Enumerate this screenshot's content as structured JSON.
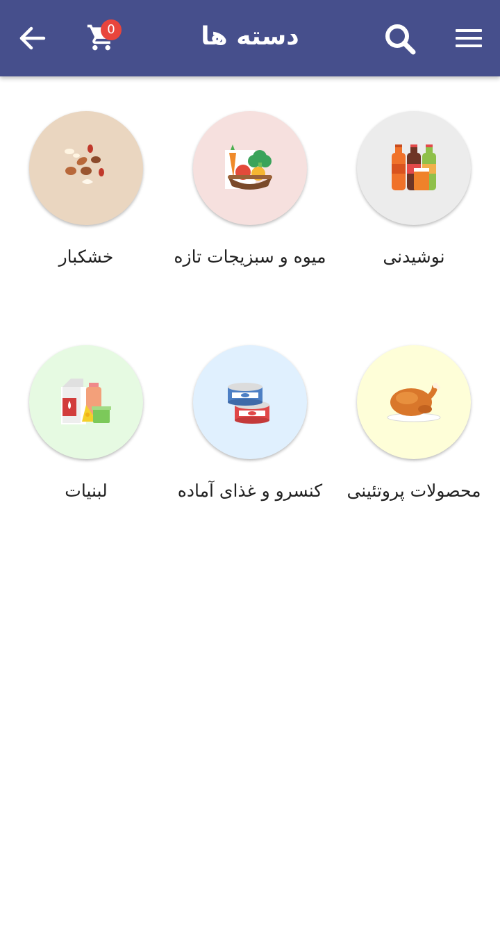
{
  "appbar": {
    "title": "دسته ها",
    "cart_count": "0",
    "background": "#464f8c"
  },
  "icons": [
    "menu-icon",
    "search-icon",
    "cart-icon",
    "back-arrow-icon"
  ],
  "categories": [
    {
      "label": "نوشیدنی",
      "icon": "soda-bottles-icon",
      "bg": "#ececec"
    },
    {
      "label": "میوه و سبزیجات تازه",
      "icon": "vegetable-basket-icon",
      "bg": "#f6e0de"
    },
    {
      "label": "خشکبار",
      "icon": "nuts-icon",
      "bg": "#ead6c0"
    },
    {
      "label": "محصولات پروتئینی",
      "icon": "roast-chicken-icon",
      "bg": "#fefed8"
    },
    {
      "label": "کنسرو و غذای آماده",
      "icon": "canned-food-icon",
      "bg": "#e0f0fe"
    },
    {
      "label": "لبنیات",
      "icon": "dairy-products-icon",
      "bg": "#e6fae2"
    }
  ]
}
